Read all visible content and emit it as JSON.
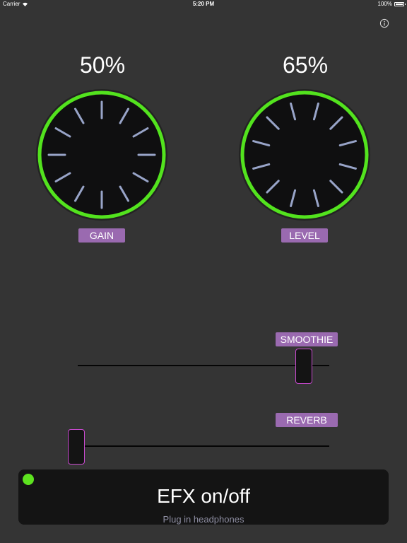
{
  "status_bar": {
    "carrier": "Carrier",
    "time": "5:20 PM",
    "battery": "100%"
  },
  "info_button": {
    "icon": "info-icon"
  },
  "knobs": [
    {
      "label": "GAIN",
      "value_text": "50%",
      "value": 50,
      "ring_color": "#53e31e"
    },
    {
      "label": "LEVEL",
      "value_text": "65%",
      "value": 65,
      "ring_color": "#53e31e"
    }
  ],
  "sliders": [
    {
      "label": "SMOOTHIE",
      "value": 0.93
    },
    {
      "label": "REVERB",
      "value": 0.0
    }
  ],
  "efx_button": {
    "title": "EFX on/off",
    "subtitle": "Plug in headphones",
    "led_color": "#5de21f"
  },
  "colors": {
    "background": "#343434",
    "accent": "#9a6ab0",
    "thumb_border": "#c94ad0",
    "tick": "#98a4c8"
  }
}
